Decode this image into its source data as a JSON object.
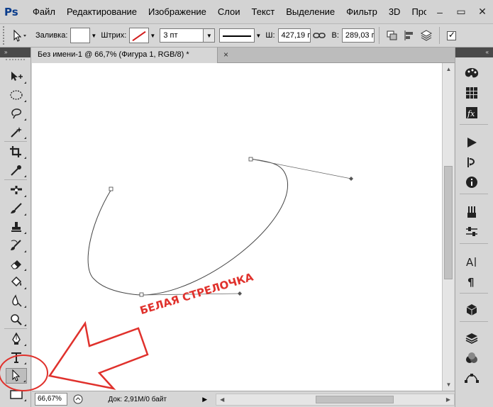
{
  "app": {
    "logo": "Ps"
  },
  "menu": {
    "items": [
      {
        "label": "Файл"
      },
      {
        "label": "Редактирование"
      },
      {
        "label": "Изображение"
      },
      {
        "label": "Слои"
      },
      {
        "label": "Текст"
      },
      {
        "label": "Выделение"
      },
      {
        "label": "Фильтр"
      },
      {
        "label": "3D"
      },
      {
        "label": "Про"
      }
    ]
  },
  "window_controls": {
    "minimize": "–",
    "restore": "▭",
    "close": "✕"
  },
  "options": {
    "fill_label": "Заливка:",
    "stroke_label": "Штрих:",
    "stroke_width": "3 пт",
    "width_label": "Ш:",
    "width_value": "427,19 г",
    "height_label": "В:",
    "height_value": "289,03 г",
    "stroke_color": "#d21c1c"
  },
  "document": {
    "tab_title": "Без имени-1 @ 66,7% (Фигура 1, RGB/8) *",
    "close": "×"
  },
  "status": {
    "zoom": "66,67%",
    "doc_size": "Док: 2,91M/0 байт"
  },
  "annotation": {
    "text": "БЕЛАЯ СТРЕЛОЧКА",
    "color": "#e0312c"
  },
  "tools": [
    {
      "name": "move-tool-icon"
    },
    {
      "name": "elliptical-marquee-tool-icon"
    },
    {
      "name": "lasso-tool-icon"
    },
    {
      "name": "magic-wand-tool-icon"
    },
    {
      "name": "crop-tool-icon"
    },
    {
      "name": "eyedropper-tool-icon"
    },
    {
      "name": "spot-healing-tool-icon"
    },
    {
      "name": "brush-tool-icon"
    },
    {
      "name": "clone-stamp-tool-icon"
    },
    {
      "name": "history-brush-tool-icon"
    },
    {
      "name": "eraser-tool-icon"
    },
    {
      "name": "paint-bucket-tool-icon"
    },
    {
      "name": "blur-tool-icon"
    },
    {
      "name": "dodge-tool-icon"
    },
    {
      "name": "pen-tool-icon"
    },
    {
      "name": "type-tool-icon"
    },
    {
      "name": "direct-selection-tool-icon"
    },
    {
      "name": "rectangle-tool-icon"
    }
  ]
}
